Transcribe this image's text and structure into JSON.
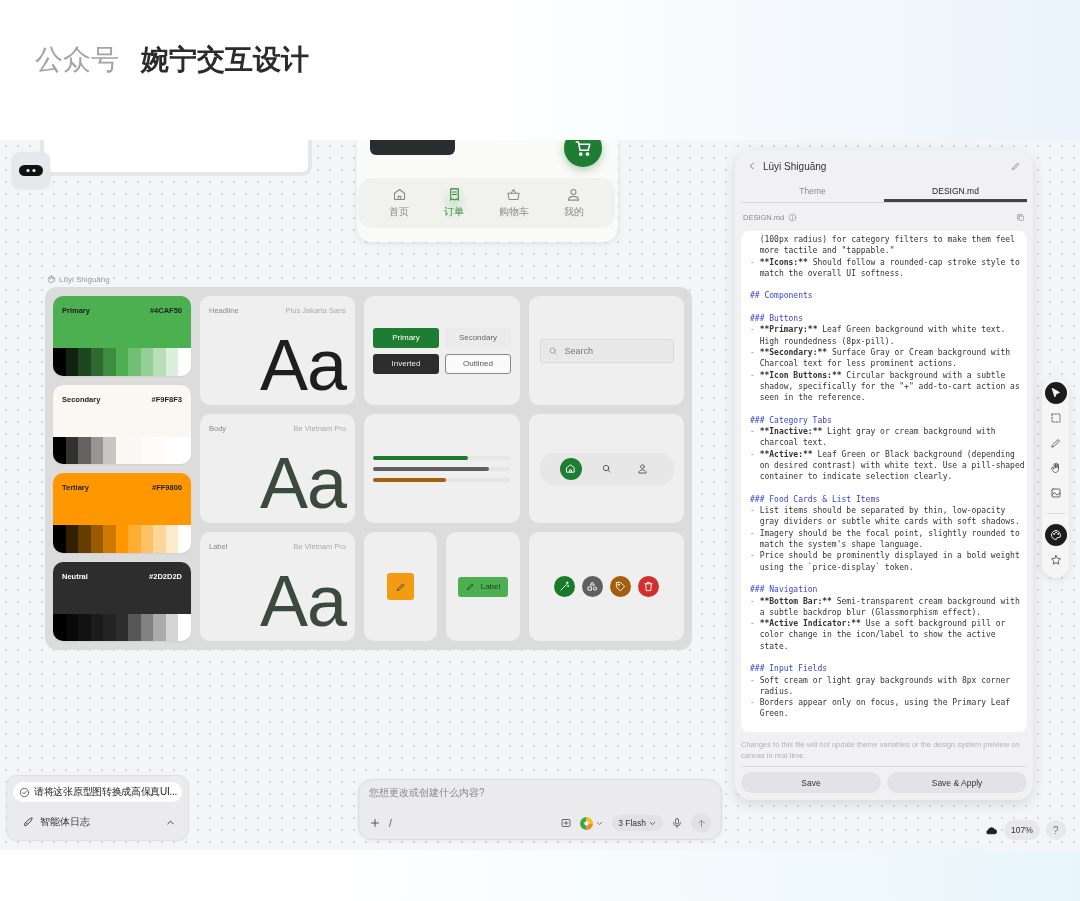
{
  "header": {
    "label": "公众号",
    "title": "婉宁交互设计"
  },
  "phone_nav": {
    "items": [
      {
        "label": "首页",
        "kind": "home",
        "selected": false
      },
      {
        "label": "订单",
        "kind": "receipt",
        "selected": true
      },
      {
        "label": "购物车",
        "kind": "basket",
        "selected": false
      },
      {
        "label": "我的",
        "kind": "user",
        "selected": false
      }
    ]
  },
  "board": {
    "title": "Lüyi Shiguāng",
    "colors": [
      {
        "name": "Primary",
        "hex": "#4CAF50",
        "color": "#4caf50"
      },
      {
        "name": "Secondary",
        "hex": "#F9F8F3",
        "color": "#f9f8f3"
      },
      {
        "name": "Tertiary",
        "hex": "#FF9800",
        "color": "#ff9800"
      },
      {
        "name": "Neutral",
        "hex": "#2D2D2D",
        "color": "#2d2d2d"
      }
    ],
    "type_styles": [
      {
        "kind": "headline",
        "role": "Headline",
        "family": "Plus Jakarta Sans",
        "sample": "Aa"
      },
      {
        "kind": "body",
        "role": "Body",
        "family": "Be Vietnam Pro",
        "sample": "Aa"
      },
      {
        "kind": "label",
        "role": "Label",
        "family": "Be Vietnam Pro",
        "sample": "Aa"
      }
    ],
    "buttons": [
      {
        "label": "Primary",
        "kind": "primary"
      },
      {
        "label": "Secondary",
        "kind": "secondary"
      },
      {
        "label": "Inverted",
        "kind": "inverted"
      },
      {
        "label": "Outlined",
        "kind": "outlined"
      }
    ],
    "search": {
      "placeholder": "Search"
    },
    "progress": [
      {
        "level": 0.69,
        "color": "#1b7a2a"
      },
      {
        "level": 0.85,
        "color": "#5f5f5f"
      },
      {
        "level": 0.53,
        "color": "#a35f0e"
      }
    ],
    "nav_pill": [
      {
        "kind": "home",
        "selected": true
      },
      {
        "kind": "search",
        "selected": false
      },
      {
        "kind": "user",
        "selected": false
      }
    ],
    "chip": {
      "label": "Label"
    },
    "icon_buttons": [
      {
        "kind": "wand",
        "color": "#1b7a2a"
      },
      {
        "kind": "shapes",
        "color": "#5f5f5f"
      },
      {
        "kind": "tag",
        "color": "#a35f0e"
      },
      {
        "kind": "trash",
        "color": "#d32f2f"
      }
    ]
  },
  "panel": {
    "title": "Lüyi Shiguāng",
    "tabs": [
      {
        "label": "Theme",
        "selected": false
      },
      {
        "label": "DESIGN.md",
        "selected": true
      }
    ],
    "file_label": "DESIGN.md",
    "doc": [
      {
        "kind": "cont",
        "text": "(100px radius) for category filters to make them feel more tactile and \"tappable.\""
      },
      {
        "kind": "bullet",
        "marker": "-",
        "key": "**Icons:**",
        "text": " Should follow a rounded-cap stroke style to match the overall UI softness."
      },
      {
        "kind": "heading",
        "text": "## Components"
      },
      {
        "kind": "heading",
        "text": "### Buttons"
      },
      {
        "kind": "bullet",
        "marker": "-",
        "key": "**Primary:**",
        "text": " Leaf Green background with white text. High roundedness (8px-pill)."
      },
      {
        "kind": "bullet",
        "marker": "-",
        "key": "**Secondary:**",
        "text": " Surface Gray or Cream background with Charcoal text for less prominent actions."
      },
      {
        "kind": "bullet",
        "marker": "-",
        "key": "**Icon Buttons:**",
        "text": " Circular background with a subtle shadow, specifically for the \"+\" add-to-cart action as seen in the reference."
      },
      {
        "kind": "heading",
        "text": "### Category Tabs"
      },
      {
        "kind": "bullet",
        "marker": "-",
        "key": "**Inactive:**",
        "text": " Light gray or cream background with charcoal text."
      },
      {
        "kind": "bullet",
        "marker": "-",
        "key": "**Active:**",
        "text": " Leaf Green or Black background (depending on desired contrast) with white text. Use a pill-shaped container to indicate selection clearly."
      },
      {
        "kind": "heading",
        "text": "### Food Cards & List Items"
      },
      {
        "kind": "bullet",
        "marker": "-",
        "text": "List items should be separated by thin, low-opacity gray dividers or subtle white cards with soft shadows."
      },
      {
        "kind": "bullet",
        "marker": "-",
        "text": "Imagery should be the focal point, slightly rounded to match the system's shape language."
      },
      {
        "kind": "bullet",
        "marker": "-",
        "text": "Price should be prominently displayed in a bold weight using the `price-display` token."
      },
      {
        "kind": "heading",
        "text": "### Navigation"
      },
      {
        "kind": "bullet",
        "marker": "-",
        "key": "**Bottom Bar:**",
        "text": " Semi-transparent cream background with a subtle backdrop blur (Glassmorphism effect)."
      },
      {
        "kind": "bullet",
        "marker": "-",
        "key": "**Active Indicator:**",
        "text": " Use a soft background pill or color change in the icon/label to show the active state."
      },
      {
        "kind": "heading",
        "text": "### Input Fields"
      },
      {
        "kind": "bullet",
        "marker": "-",
        "text": "Soft cream or light gray backgrounds with 8px corner radius."
      },
      {
        "kind": "bullet",
        "marker": "-",
        "text": "Borders appear only on focus, using the Primary Leaf Green."
      }
    ],
    "note": "Changes to this file will not update theme variables or the design system preview on canvas in real time.",
    "buttons": [
      "Save",
      "Save & Apply"
    ]
  },
  "toolbar": [
    {
      "kind": "cursor",
      "selected": true
    },
    {
      "kind": "select",
      "selected": false
    },
    {
      "kind": "pencil",
      "selected": false
    },
    {
      "kind": "hand",
      "selected": false
    },
    {
      "kind": "image",
      "selected": false
    },
    {
      "kind": "palette",
      "selected": true
    },
    {
      "kind": "star",
      "selected": false
    }
  ],
  "agent": {
    "task": "请将这张原型图转换成高保真UI...",
    "log": "智能体日志"
  },
  "chat": {
    "placeholder": "您想更改或创建什么内容?",
    "slash": "/",
    "model": "3 Flash"
  },
  "zoom": {
    "value": "107%",
    "help": "?"
  }
}
